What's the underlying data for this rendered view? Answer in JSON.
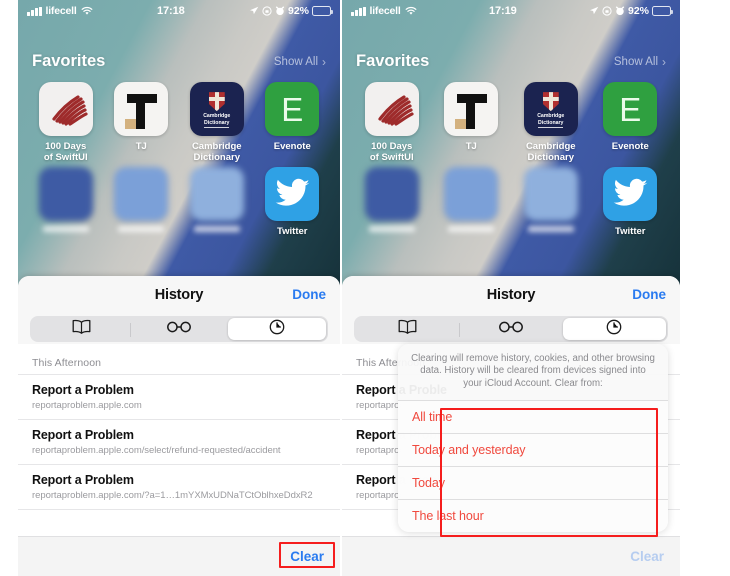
{
  "panels": [
    {
      "id": "left",
      "status_bar": {
        "carrier": "lifecell",
        "time": "17:18",
        "battery_percent": "92%",
        "icons": [
          "signal-bars-icon",
          "wifi-icon",
          "location-arrow-icon",
          "lock-rotation-icon",
          "alarm-clock-icon",
          "battery-icon"
        ]
      },
      "favorites": {
        "title": "Favorites",
        "show_all": "Show All",
        "chevron": "›",
        "apps": [
          {
            "label": "100 Days\nof SwiftUI",
            "icon": "swiftui-slashes-icon",
            "blurred": false
          },
          {
            "label": "TJ",
            "icon": "tj-letter-icon",
            "blurred": false
          },
          {
            "label": "Cambridge\nDictionary",
            "icon": "cambridge-dictionary-icon",
            "blurred": false
          },
          {
            "label": "Evenote",
            "icon": "evernote-e-icon",
            "blurred": false
          },
          {
            "label": "",
            "icon": "blurred-app-icon-1",
            "blurred": true
          },
          {
            "label": "",
            "icon": "blurred-app-icon-2",
            "blurred": true
          },
          {
            "label": "",
            "icon": "blurred-app-icon-3",
            "blurred": true
          },
          {
            "label": "Twitter",
            "icon": "twitter-bird-icon",
            "blurred": false
          }
        ]
      },
      "sheet": {
        "title": "History",
        "done_label": "Done",
        "tabs": [
          {
            "name": "bookmarks",
            "icon": "book-icon",
            "active": false
          },
          {
            "name": "reading-list",
            "icon": "glasses-icon",
            "active": false
          },
          {
            "name": "history",
            "icon": "clock-icon",
            "active": true
          }
        ],
        "section_header": "This Afternoon",
        "rows": [
          {
            "title": "Report a Problem",
            "url": "reportaproblem.apple.com"
          },
          {
            "title": "Report a Problem",
            "url": "reportaproblem.apple.com/select/refund-requested/accident"
          },
          {
            "title": "Report a Problem",
            "url": "reportaproblem.apple.com/?a=1…1mYXMxUDNaTCtOblhxeDdxR2"
          }
        ],
        "clear_label": "Clear",
        "clear_disabled": false
      },
      "action_sheet": null
    },
    {
      "id": "right",
      "status_bar": {
        "carrier": "lifecell",
        "time": "17:19",
        "battery_percent": "92%",
        "icons": [
          "signal-bars-icon",
          "wifi-icon",
          "location-arrow-icon",
          "lock-rotation-icon",
          "alarm-clock-icon",
          "battery-icon"
        ]
      },
      "favorites": {
        "title": "Favorites",
        "show_all": "Show All",
        "chevron": "›",
        "apps": [
          {
            "label": "100 Days\nof SwiftUI",
            "icon": "swiftui-slashes-icon",
            "blurred": false
          },
          {
            "label": "TJ",
            "icon": "tj-letter-icon",
            "blurred": false
          },
          {
            "label": "Cambridge\nDictionary",
            "icon": "cambridge-dictionary-icon",
            "blurred": false
          },
          {
            "label": "Evenote",
            "icon": "evernote-e-icon",
            "blurred": false
          },
          {
            "label": "",
            "icon": "blurred-app-icon-1",
            "blurred": true
          },
          {
            "label": "",
            "icon": "blurred-app-icon-2",
            "blurred": true
          },
          {
            "label": "",
            "icon": "blurred-app-icon-3",
            "blurred": true
          },
          {
            "label": "Twitter",
            "icon": "twitter-bird-icon",
            "blurred": false
          }
        ]
      },
      "sheet": {
        "title": "History",
        "done_label": "Done",
        "tabs": [
          {
            "name": "bookmarks",
            "icon": "book-icon",
            "active": false
          },
          {
            "name": "reading-list",
            "icon": "glasses-icon",
            "active": false
          },
          {
            "name": "history",
            "icon": "clock-icon",
            "active": true
          }
        ],
        "section_header": "This Afternoon",
        "rows": [
          {
            "title": "Report a Proble",
            "url": "reportaproblem.app"
          },
          {
            "title": "Report a Proble",
            "url": "reportaproblem.app"
          },
          {
            "title": "Report a Proble",
            "url": "reportaproblem.app"
          }
        ],
        "clear_label": "Clear",
        "clear_disabled": true
      },
      "action_sheet": {
        "message": "Clearing will remove history, cookies, and other browsing data. History will be cleared from devices signed into your iCloud Account. Clear from:",
        "options": [
          {
            "label": "All time"
          },
          {
            "label": "Today and yesterday"
          },
          {
            "label": "Today"
          },
          {
            "label": "The last hour"
          }
        ]
      }
    }
  ],
  "annotations": [
    {
      "name": "clear-button-highlight",
      "target": "left-clear-button"
    },
    {
      "name": "clear-options-highlight",
      "target": "right-action-sheet-options"
    }
  ],
  "colors": {
    "accent_blue": "#2a7bf0",
    "destructive_red": "#f0493e",
    "annotation_red": "#f51d1d",
    "sheet_background": "#f7f7f7"
  }
}
